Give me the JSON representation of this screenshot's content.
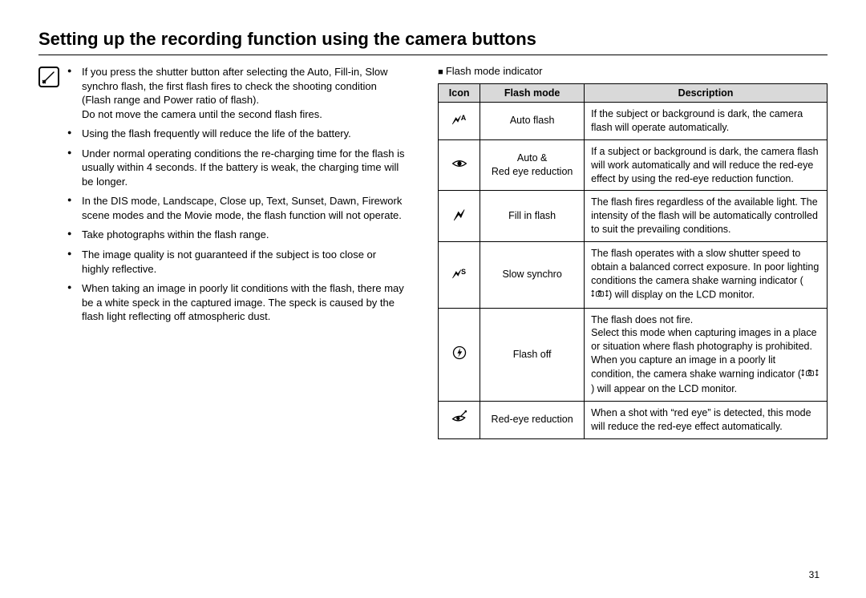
{
  "title": "Setting up the recording function using the camera buttons",
  "notes": {
    "items": [
      {
        "text": "If you press the shutter button after selecting the Auto, Fill-in, Slow synchro flash, the first flash fires to check the shooting condition (Flash range and Power ratio of flash).",
        "sub": "Do not move the camera until the second flash fires."
      },
      {
        "text": "Using the flash frequently will reduce the life of the battery."
      },
      {
        "text": "Under normal operating conditions the re-charging time for the flash is usually within 4 seconds. If the battery is weak, the charging time will be longer."
      },
      {
        "text": "In the DIS mode, Landscape, Close up, Text, Sunset, Dawn, Firework scene modes and the Movie mode, the flash function will not operate."
      },
      {
        "text": "Take photographs within the flash range."
      },
      {
        "text": "The image quality is not guaranteed if the subject is too close or highly reflective."
      },
      {
        "text": "When taking an image in poorly lit conditions with the flash, there may be a white speck in the captured image. The speck is caused by the flash light reflecting off atmospheric dust."
      }
    ]
  },
  "section_label": "Flash mode indicator",
  "table": {
    "headers": {
      "icon": "Icon",
      "mode": "Flash mode",
      "desc": "Description"
    },
    "rows": [
      {
        "icon_name": "flash-auto-icon",
        "mode": "Auto flash",
        "desc": "If the subject or background is dark, the camera flash will operate automatically."
      },
      {
        "icon_name": "red-eye-icon",
        "mode": "Auto &\nRed eye reduction",
        "desc": "If a subject or background is dark, the camera flash will work automatically and will reduce the red-eye effect by using the red-eye reduction function."
      },
      {
        "icon_name": "fill-flash-icon",
        "mode": "Fill in flash",
        "desc": "The flash fires regardless of the available light. The intensity of the flash will be automatically controlled to suit the prevailing conditions."
      },
      {
        "icon_name": "slow-synchro-icon",
        "mode": "Slow synchro",
        "desc_pre": "The flash operates with a slow shutter speed to obtain a balanced correct exposure. In poor lighting conditions the camera shake warning indicator (",
        "desc_post": ") will display on the LCD monitor."
      },
      {
        "icon_name": "flash-off-icon",
        "mode": "Flash off",
        "desc_pre": "The flash does not fire.\nSelect this mode when capturing images in a place or situation where flash photography is prohibited. When you capture an image in a poorly lit condition, the camera shake warning indicator (",
        "desc_post": ") will appear on the LCD monitor."
      },
      {
        "icon_name": "red-eye-fix-icon",
        "mode": "Red-eye reduction",
        "desc": "When a shot with “red eye” is detected, this mode will reduce the red-eye effect automatically."
      }
    ]
  },
  "page_number": "31"
}
